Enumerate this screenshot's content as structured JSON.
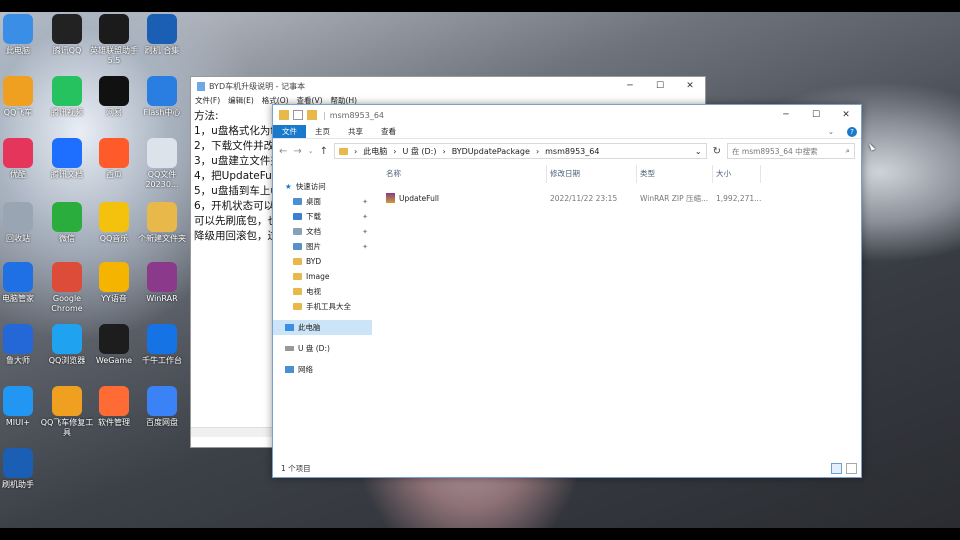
{
  "desktop_icons": [
    {
      "label": "此电脑",
      "icon": "computer-icon",
      "color": "#3a8ee6"
    },
    {
      "label": "腾讯QQ",
      "icon": "qq-icon",
      "color": "#222222"
    },
    {
      "label": "英雄联盟助手 5.5",
      "icon": "lol-icon",
      "color": "#1b1b1b"
    },
    {
      "label": "刷机 合集",
      "icon": "flash-icon",
      "color": "#1a5fb4"
    },
    {
      "label": "QQ飞车",
      "icon": "qqspeed-icon",
      "color": "#f0a020"
    },
    {
      "label": "腾讯视频",
      "icon": "video-icon",
      "color": "#26c25f"
    },
    {
      "label": "网易",
      "icon": "netease-icon",
      "color": "#111111"
    },
    {
      "label": "Flash中心",
      "icon": "flash-center-icon",
      "color": "#2a7de1"
    },
    {
      "label": "优酷",
      "icon": "youku-icon",
      "color": "#e5355a"
    },
    {
      "label": "腾讯文档",
      "icon": "docs-icon",
      "color": "#1e6fff"
    },
    {
      "label": "西瓜",
      "icon": "xigua-icon",
      "color": "#ff5a2a"
    },
    {
      "label": "QQ文件 20230...",
      "icon": "file-icon",
      "color": "#dde3ea"
    },
    {
      "label": "回收站",
      "icon": "recycle-icon",
      "color": "#9aa5b3"
    },
    {
      "label": "微信",
      "icon": "wechat-icon",
      "color": "#2bad3e"
    },
    {
      "label": "QQ音乐",
      "icon": "qqmusic-icon",
      "color": "#f4c20d"
    },
    {
      "label": "个新建文件夹",
      "icon": "folder-icon",
      "color": "#e8b84b"
    },
    {
      "label": "电脑管家",
      "icon": "shield-icon",
      "color": "#1f6fe5"
    },
    {
      "label": "Google Chrome",
      "icon": "chrome-icon",
      "color": "#dd4b39"
    },
    {
      "label": "YY语音",
      "icon": "yy-icon",
      "color": "#f5b400"
    },
    {
      "label": "WinRAR",
      "icon": "winrar-icon",
      "color": "#8b3a8b"
    },
    {
      "label": "鲁大师",
      "icon": "ludashi-icon",
      "color": "#2468d8"
    },
    {
      "label": "QQ浏览器",
      "icon": "qqbrowser-icon",
      "color": "#1fa3f0"
    },
    {
      "label": "WeGame",
      "icon": "wegame-icon",
      "color": "#1d1d1d"
    },
    {
      "label": "千牛工作台",
      "icon": "qianniu-icon",
      "color": "#1573e6"
    },
    {
      "label": "MIUI+",
      "icon": "miui-icon",
      "color": "#2196f3"
    },
    {
      "label": "QQ飞车修复工具",
      "icon": "repair-icon",
      "color": "#f0a020"
    },
    {
      "label": "软件管理",
      "icon": "apps-icon",
      "color": "#ff6b35"
    },
    {
      "label": "百度网盘",
      "icon": "baidu-icon",
      "color": "#3b82f6"
    },
    {
      "label": "刷机助手",
      "icon": "flash2-icon",
      "color": "#1a5fb4"
    }
  ],
  "notepad": {
    "title": "BYD车机升级说明 - 记事本",
    "menus": [
      "文件(F)",
      "编辑(E)",
      "格式(O)",
      "查看(V)",
      "帮助(H)"
    ],
    "lines": [
      "方法:",
      "1，u盘格式化为fa",
      "2，下载文件并改名",
      "3，u盘建立文件夹",
      "4，把UpdateFull.",
      "5，u盘插到车上u",
      "6，开机状态可以D",
      "可以先刷底包，也",
      "降级用回滚包，过"
    ]
  },
  "explorer": {
    "title": "msm8953_64",
    "ribbon_tabs": [
      "文件",
      "主页",
      "共享",
      "查看"
    ],
    "breadcrumb": [
      "此电脑",
      "U 盘 (D:)",
      "BYDUpdatePackage",
      "msm8953_64"
    ],
    "search_placeholder": "在 msm8953_64 中搜索",
    "nav": {
      "quick_access": "快速访问",
      "quick_items": [
        "桌面",
        "下载",
        "文档",
        "图片",
        "BYD",
        "Image",
        "电视",
        "手机工具大全"
      ],
      "this_pc": "此电脑",
      "usb": "U 盘 (D:)",
      "network": "网络"
    },
    "columns": [
      "名称",
      "修改日期",
      "类型",
      "大小"
    ],
    "files": [
      {
        "name": "UpdateFull",
        "modified": "2022/11/22 23:15",
        "type": "WinRAR ZIP 压缩...",
        "size": "1,992,271..."
      }
    ],
    "status": "1 个项目"
  },
  "colors": {
    "accent": "#1979ca",
    "selection": "#cce4f7"
  }
}
